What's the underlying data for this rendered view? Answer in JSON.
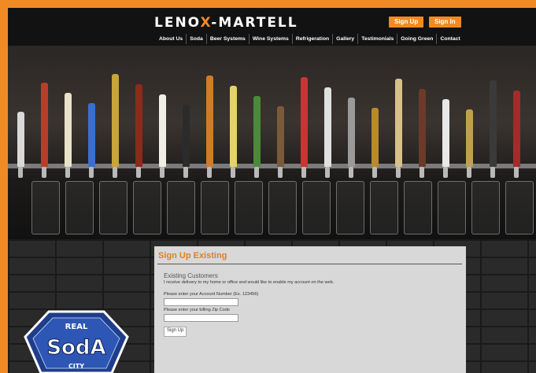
{
  "brand": {
    "logo_left": "LENO",
    "logo_x": "X",
    "logo_right": "-MARTELL",
    "accent": "#f08a24"
  },
  "header": {
    "signup_label": "Sign Up",
    "signin_label": "Sign In"
  },
  "nav": [
    "About Us",
    "Soda",
    "Beer Systems",
    "Wine Systems",
    "Refrigeration",
    "Gallery",
    "Testimonials",
    "Going Green",
    "Contact"
  ],
  "form": {
    "title": "Sign Up Existing",
    "heading": "Existing Customers",
    "subtext": "I receive delivery to my home or office and would like to enable my account on the web.",
    "account_label": "Please enter your Account Number (Ex. 123456)",
    "account_value": "",
    "zip_label": "Please enter your billing Zip Code",
    "zip_value": "",
    "submit_label": "Sign Up"
  },
  "badge": {
    "top": "REAL",
    "main": "SodA",
    "bottom": "CITY"
  }
}
